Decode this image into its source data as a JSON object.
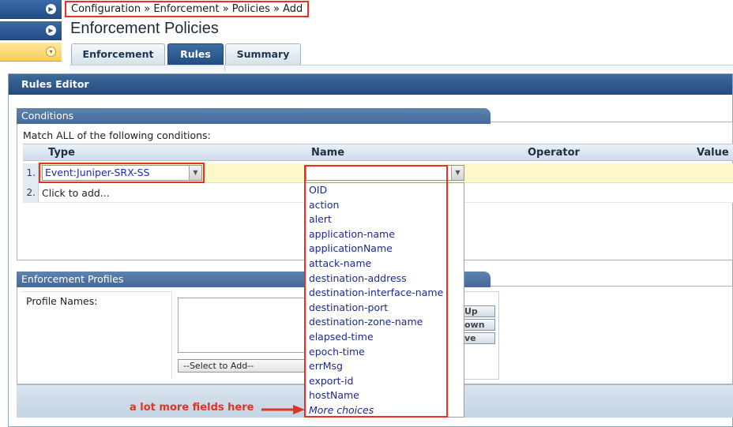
{
  "breadcrumb": "Configuration » Enforcement » Policies » Add",
  "page_title": "Enforcement Policies",
  "tabs": [
    {
      "label": "Enforcement",
      "active": false
    },
    {
      "label": "Rules",
      "active": true
    },
    {
      "label": "Summary",
      "active": false
    }
  ],
  "left_nav_icons": [
    "plus-circle-icon",
    "plus-circle-icon",
    "chevron-down-circle-icon"
  ],
  "dialog": {
    "title": "Rules Editor",
    "conditions": {
      "header": "Conditions",
      "caption": "Match ALL of the following conditions:",
      "columns": [
        "Type",
        "Name",
        "Operator",
        "Value"
      ],
      "rows": [
        {
          "num": "1.",
          "type": "Event:Juniper-SRX-SS",
          "name": ""
        },
        {
          "num": "2.",
          "text": "Click to add..."
        }
      ]
    },
    "name_dropdown_options": [
      "OID",
      "action",
      "alert",
      "application-name",
      "applicationName",
      "attack-name",
      "destination-address",
      "destination-interface-name",
      "destination-port",
      "destination-zone-name",
      "elapsed-time",
      "epoch-time",
      "errMsg",
      "export-id",
      "hostName",
      "More choices"
    ],
    "enforcement_profiles": {
      "header": "Enforcement Profiles",
      "label": "Profile Names:",
      "select_placeholder": "--Select to Add--",
      "side_buttons": [
        "Up",
        "own",
        "ve"
      ]
    }
  },
  "annotation": "a lot more fields here",
  "colors": {
    "highlight_red": "#e53323",
    "header_blue": "#244c7c",
    "row_yellow": "#fff7cc"
  }
}
